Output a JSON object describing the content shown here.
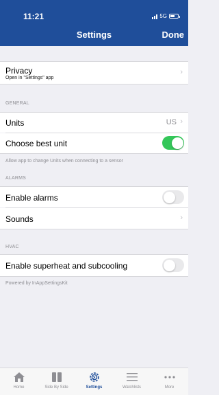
{
  "status_bar": {
    "time": "11:21",
    "network": "5G"
  },
  "nav": {
    "title": "Settings",
    "done_label": "Done"
  },
  "privacy": {
    "label": "Privacy",
    "subtitle": "Open in \"Settings\" app"
  },
  "general": {
    "header": "GENERAL",
    "units_label": "Units",
    "units_value": "US",
    "best_unit_label": "Choose best unit",
    "best_unit_on": true,
    "footer": "Allow app to change Units when connecting to a sensor"
  },
  "alarms": {
    "header": "ALARMS",
    "enable_label": "Enable alarms",
    "enable_on": false,
    "sounds_label": "Sounds"
  },
  "hvac": {
    "header": "HVAC",
    "superheat_label": "Enable superheat and subcooling",
    "superheat_on": false
  },
  "footer_text": "Powered by InAppSettingsKit",
  "tabs": [
    {
      "label": "Home",
      "icon": "home-icon",
      "active": false
    },
    {
      "label": "Side By Side",
      "icon": "side-by-side-icon",
      "active": false
    },
    {
      "label": "Settings",
      "icon": "gear-icon",
      "active": true
    },
    {
      "label": "Watchlists",
      "icon": "list-icon",
      "active": false
    },
    {
      "label": "More",
      "icon": "more-icon",
      "active": false
    }
  ],
  "colors": {
    "header": "#1f4e9a",
    "toggle_on": "#34c759",
    "accent": "#1f4e9a"
  }
}
